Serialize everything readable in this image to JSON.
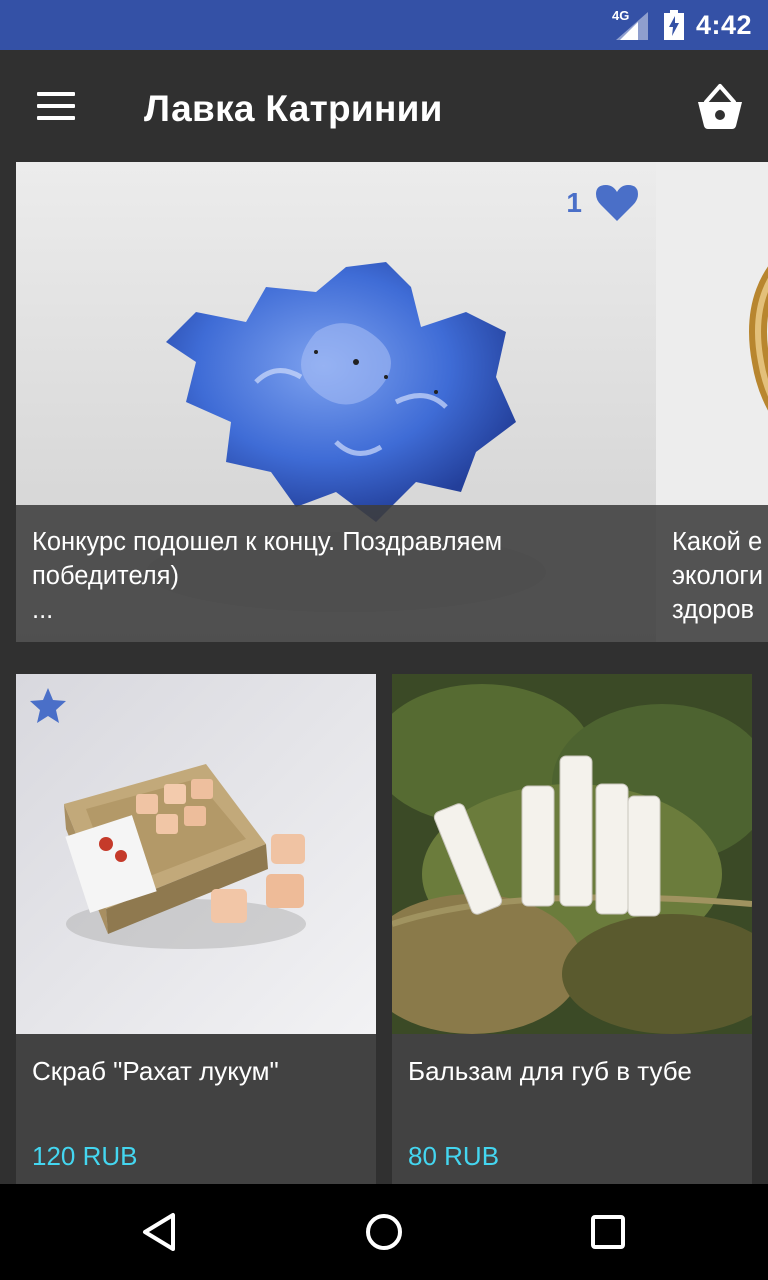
{
  "status_bar": {
    "network": "4G",
    "time": "4:42",
    "bg_color": "#3451a6",
    "icons": [
      "signal-icon",
      "battery-icon"
    ]
  },
  "app_bar": {
    "title": "Лавка Катринии",
    "icons": [
      "menu-icon",
      "basket-icon"
    ]
  },
  "carousel": {
    "slides": [
      {
        "caption_line1": "Конкурс подошел к концу. Поздравляем",
        "caption_line2": "победителя)",
        "caption_line3": "...",
        "likes": "1",
        "image": "blue-snowflake-soap"
      },
      {
        "caption_line1": "Какой е",
        "caption_line2": "экологи",
        "caption_line3": "здоров",
        "image": "gold-bracelet"
      }
    ]
  },
  "products": [
    {
      "title": "Скраб \"Рахат лукум\"",
      "price": "120 RUB",
      "favorited": true,
      "image": "scrub-box-with-cubes"
    },
    {
      "title": "Бальзам для губ в тубе",
      "price": "80 RUB",
      "favorited": false,
      "image": "lip-balm-tubes-on-leaves"
    }
  ],
  "colors": {
    "accent_blue": "#4a6fc8",
    "price_cyan": "#44d6f0",
    "background": "#303030",
    "card_bg": "#424242"
  },
  "nav_bar": {
    "icons": [
      "back-icon",
      "home-icon",
      "recents-icon"
    ]
  }
}
